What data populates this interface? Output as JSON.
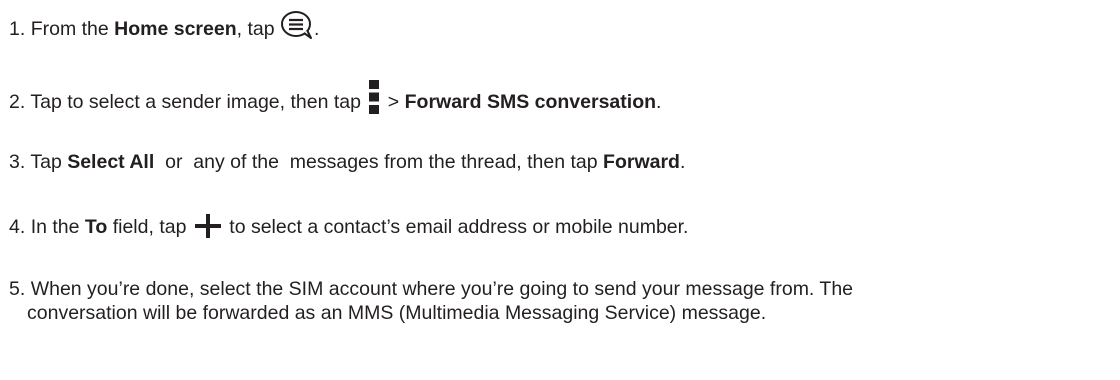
{
  "steps": [
    {
      "number": "1.",
      "pre": "From the ",
      "bold1": "Home screen",
      "mid": ", tap ",
      "icon": "messages-icon",
      "post": "."
    },
    {
      "number": "2.",
      "pre": "Tap to select a sender image, then tap ",
      "icon": "menu-icon",
      "mid": " > ",
      "bold1": "Forward SMS conversation",
      "post": "."
    },
    {
      "number": "3.",
      "pre": "Tap ",
      "bold1": "Select All",
      "mid": "  or  any of the  messages from the thread, then tap ",
      "bold2": "Forward",
      "post": "."
    },
    {
      "number": "4.",
      "pre": "In the ",
      "bold1": "To",
      "mid": " field, tap ",
      "icon": "plus-icon",
      "post": " to select a contact’s email address or mobile number."
    },
    {
      "number": "5.",
      "line1": "When you’re done, select the SIM account where you’re going to send your message from. The",
      "line2": "conversation will be forwarded as an MMS (Multimedia Messaging Service) message."
    }
  ]
}
